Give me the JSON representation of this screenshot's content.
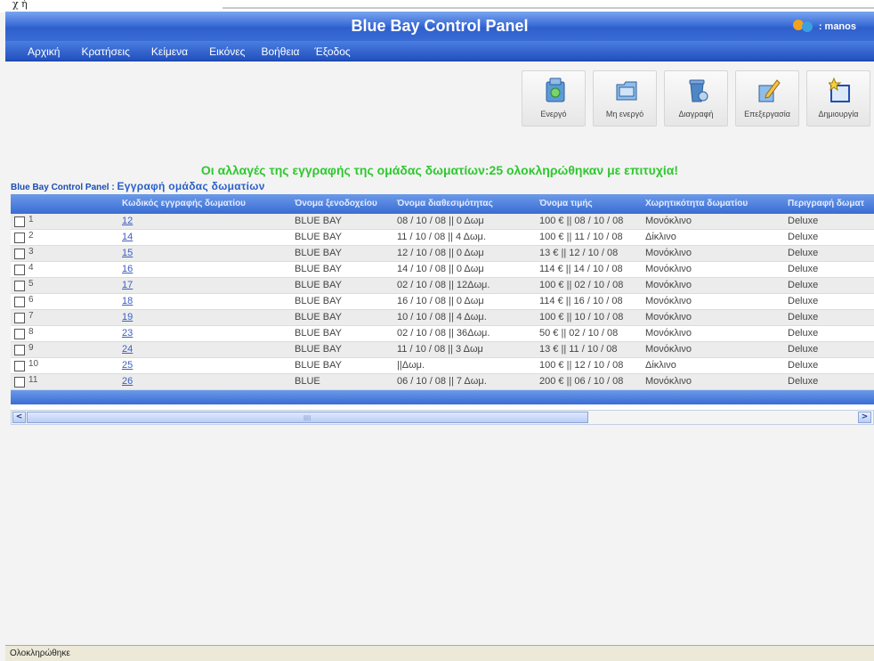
{
  "top_fragment": "χ ή",
  "header": {
    "title": "Blue Bay Control Panel",
    "user": ": manos"
  },
  "menu": [
    "Αρχική",
    "Κρατήσεις",
    "Κείμενα",
    "Εικόνες",
    "Βοήθεια",
    "Έξοδος"
  ],
  "toolbar": [
    {
      "label": "Ενεργό",
      "icon": "activate-icon",
      "color": "#5a9bd4"
    },
    {
      "label": "Μη ενεργό",
      "icon": "deactivate-icon",
      "color": "#6fa7e0"
    },
    {
      "label": "Διαγραφή",
      "icon": "recycle-bin-icon",
      "color": "#4f87c5"
    },
    {
      "label": "Επεξεργασία",
      "icon": "edit-icon",
      "color": "#6fa7e0"
    },
    {
      "label": "Δημιουργία",
      "icon": "new-folder-icon",
      "color": "#2b5fc0"
    }
  ],
  "message": "Οι αλλαγές της εγγραφής της ομάδας δωματίων:25 ολοκληρώθηκαν με επιτυχία!",
  "breadcrumb": {
    "root": "Blue Bay Control Panel :",
    "page": "Εγγραφή ομάδας δωματίων"
  },
  "table": {
    "columns": [
      "Κωδικός εγγραφής δωματίου",
      "Όνομα ξενοδοχείου",
      "Όνομα διαθεσιμότητας",
      "Όνομα τιμής",
      "Χωρητικότητα δωματίου",
      "Περιγραφή δωματ"
    ],
    "rows": [
      {
        "num": "1",
        "code": "12",
        "hotel": "BLUE BAY",
        "availability": "08 / 10 / 08 || 0 Δωμ",
        "price": "100 € || 08 / 10 / 08",
        "capacity": "Μονόκλινο",
        "description": "Deluxe"
      },
      {
        "num": "2",
        "code": "14",
        "hotel": "BLUE BAY",
        "availability": "11 / 10 / 08 || 4 Δωμ.",
        "price": "100 € || 11 / 10 / 08",
        "capacity": "Δίκλινο",
        "description": "Deluxe"
      },
      {
        "num": "3",
        "code": "15",
        "hotel": "BLUE BAY",
        "availability": "12 / 10 / 08 || 0 Δωμ",
        "price": "13 € || 12 / 10 / 08",
        "capacity": "Μονόκλινο",
        "description": "Deluxe"
      },
      {
        "num": "4",
        "code": "16",
        "hotel": "BLUE BAY",
        "availability": "14 / 10 / 08 || 0 Δωμ",
        "price": "114 € || 14 / 10 / 08",
        "capacity": "Μονόκλινο",
        "description": "Deluxe"
      },
      {
        "num": "5",
        "code": "17",
        "hotel": "BLUE BAY",
        "availability": "02 / 10 / 08 || 12Δωμ.",
        "price": "100 € || 02 / 10 / 08",
        "capacity": "Μονόκλινο",
        "description": "Deluxe"
      },
      {
        "num": "6",
        "code": "18",
        "hotel": "BLUE BAY",
        "availability": "16 / 10 / 08 || 0 Δωμ",
        "price": "114 € || 16 / 10 / 08",
        "capacity": "Μονόκλινο",
        "description": "Deluxe"
      },
      {
        "num": "7",
        "code": "19",
        "hotel": "BLUE BAY",
        "availability": "10 / 10 / 08 || 4 Δωμ.",
        "price": "100 € || 10 / 10 / 08",
        "capacity": "Μονόκλινο",
        "description": "Deluxe"
      },
      {
        "num": "8",
        "code": "23",
        "hotel": "BLUE BAY",
        "availability": "02 / 10 / 08 || 36Δωμ.",
        "price": "50 € || 02 / 10 / 08",
        "capacity": "Μονόκλινο",
        "description": "Deluxe"
      },
      {
        "num": "9",
        "code": "24",
        "hotel": "BLUE BAY",
        "availability": "11 / 10 / 08 || 3 Δωμ",
        "price": "13 € || 11 / 10 / 08",
        "capacity": "Μονόκλινο",
        "description": "Deluxe"
      },
      {
        "num": "10",
        "code": "25",
        "hotel": "BLUE BAY",
        "availability": "||Δωμ.",
        "price": "100 € || 12 / 10 / 08",
        "capacity": "Δίκλινο",
        "description": "Deluxe"
      },
      {
        "num": "11",
        "code": "26",
        "hotel": "BLUE",
        "availability": "06 / 10 / 08 || 7 Δωμ.",
        "price": "200 € || 06 / 10 / 08",
        "capacity": "Μονόκλινο",
        "description": "Deluxe"
      }
    ]
  },
  "scrollbar": {
    "left_arrow": "<",
    "right_arrow": ">",
    "grip": "||||"
  },
  "status": "Ολοκληρώθηκε",
  "colors": {
    "header": "#3d6fd8",
    "message": "#2ec82e",
    "link": "#3a5fc0"
  }
}
